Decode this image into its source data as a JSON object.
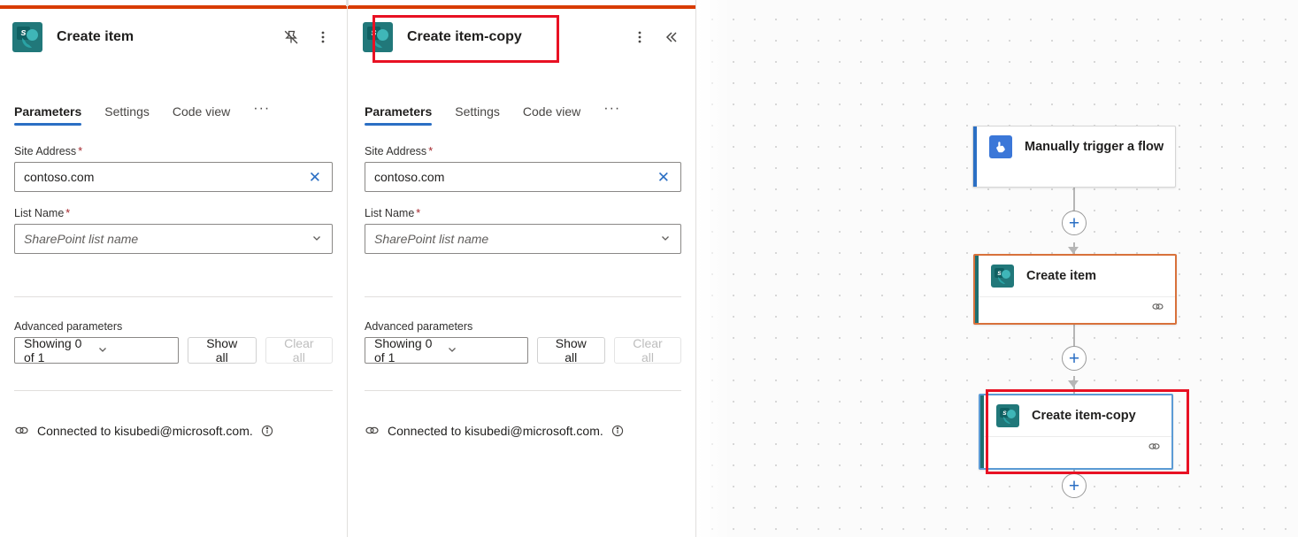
{
  "panels": [
    {
      "id": "left",
      "title": "Create item",
      "icon": "sharepoint-icon",
      "actions": [
        {
          "name": "pin-off-icon",
          "label": "Unpin"
        },
        {
          "name": "more-options-icon",
          "label": "More commands"
        }
      ],
      "tabs": [
        {
          "label": "Parameters",
          "active": true
        },
        {
          "label": "Settings",
          "active": false
        },
        {
          "label": "Code view",
          "active": false
        }
      ],
      "tab_overflow": "···",
      "fields": [
        {
          "label": "Site Address",
          "required": "*",
          "value": "contoso.com",
          "placeholder": "",
          "type": "text-with-clear"
        },
        {
          "label": "List Name",
          "required": "*",
          "value": "",
          "placeholder": "SharePoint list name",
          "type": "dropdown"
        }
      ],
      "advanced": {
        "label": "Advanced parameters",
        "select_value": "Showing 0 of 1",
        "show_all": "Show all",
        "clear_all": "Clear all",
        "clear_all_disabled": true
      },
      "connection": {
        "text": "Connected to kisubedi@microsoft.com.",
        "plug_icon": "connection-icon",
        "info_icon": "info-icon"
      }
    },
    {
      "id": "right",
      "title": "Create item-copy",
      "icon": "sharepoint-icon",
      "actions": [
        {
          "name": "more-options-icon",
          "label": "More commands"
        },
        {
          "name": "collapse-icon",
          "label": "Collapse"
        }
      ],
      "tabs": [
        {
          "label": "Parameters",
          "active": true
        },
        {
          "label": "Settings",
          "active": false
        },
        {
          "label": "Code view",
          "active": false
        }
      ],
      "tab_overflow": "···",
      "fields": [
        {
          "label": "Site Address",
          "required": "*",
          "value": "contoso.com",
          "placeholder": "",
          "type": "text-with-clear"
        },
        {
          "label": "List Name",
          "required": "*",
          "value": "",
          "placeholder": "SharePoint list name",
          "type": "dropdown"
        }
      ],
      "advanced": {
        "label": "Advanced parameters",
        "select_value": "Showing 0 of 1",
        "show_all": "Show all",
        "clear_all": "Clear all",
        "clear_all_disabled": true
      },
      "connection": {
        "text": "Connected to kisubedi@microsoft.com.",
        "plug_icon": "connection-icon",
        "info_icon": "info-icon"
      }
    }
  ],
  "canvas": {
    "nodes": [
      {
        "id": "trigger",
        "title": "Manually trigger a flow",
        "icon": "manual-trigger-icon",
        "accent_color": "#2b6fc4",
        "has_footer": false,
        "selected": false
      },
      {
        "id": "create-item",
        "title": "Create item",
        "icon": "sharepoint-icon",
        "accent_color": "#1f6f70",
        "border_color": "#d8713b",
        "has_footer": true,
        "footer_icon": "link-icon",
        "selected": true
      },
      {
        "id": "create-item-copy",
        "title": "Create item-copy",
        "icon": "sharepoint-icon",
        "accent_color": "#1f6f70",
        "border_color": "#5b9bd5",
        "has_footer": true,
        "footer_icon": "link-icon",
        "selected": true
      }
    ],
    "add_buttons": [
      {
        "label": "+"
      },
      {
        "label": "+"
      },
      {
        "label": "+"
      }
    ]
  },
  "annotations": {
    "color": "#e81123",
    "boxes": [
      {
        "target": "panel-right-title"
      },
      {
        "target": "node-create-item-copy"
      }
    ]
  }
}
